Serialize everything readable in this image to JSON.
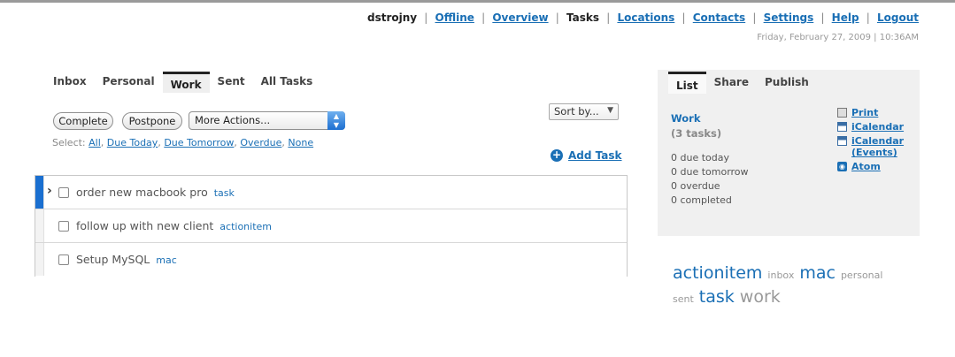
{
  "header": {
    "username": "dstrojny",
    "links": [
      {
        "label": "Offline",
        "current": false
      },
      {
        "label": "Overview",
        "current": false
      },
      {
        "label": "Tasks",
        "current": true
      },
      {
        "label": "Locations",
        "current": false
      },
      {
        "label": "Contacts",
        "current": false
      },
      {
        "label": "Settings",
        "current": false
      },
      {
        "label": "Help",
        "current": false
      },
      {
        "label": "Logout",
        "current": false
      }
    ],
    "datetime": "Friday, February 27, 2009 | 10:36AM"
  },
  "tabs": [
    "Inbox",
    "Personal",
    "Work",
    "Sent",
    "All Tasks"
  ],
  "active_tab": "Work",
  "toolbar": {
    "complete_label": "Complete",
    "postpone_label": "Postpone",
    "more_actions_label": "More Actions...",
    "sort_label": "Sort by..."
  },
  "select": {
    "prefix": "Select:",
    "options": [
      "All",
      "Due Today",
      "Due Tomorrow",
      "Overdue",
      "None"
    ]
  },
  "add_task_label": "Add Task",
  "tasks": [
    {
      "name": "order new macbook pro",
      "tag": "task",
      "selected": true
    },
    {
      "name": "follow up with new client",
      "tag": "actionitem",
      "selected": false
    },
    {
      "name": "Setup MySQL",
      "tag": "mac",
      "selected": false
    }
  ],
  "sidebar": {
    "tabs": [
      "List",
      "Share",
      "Publish"
    ],
    "active_tab": "List",
    "list_name": "Work",
    "task_count": "(3 tasks)",
    "stats": [
      "0 due today",
      "0 due tomorrow",
      "0 overdue",
      "0 completed"
    ],
    "actions": [
      "Print",
      "iCalendar",
      "iCalendar (Events)",
      "Atom"
    ]
  },
  "tag_cloud": [
    {
      "tag": "actionitem",
      "color": "#1a6fb5"
    },
    {
      "tag": "inbox",
      "color": "#999999"
    },
    {
      "tag": "mac",
      "color": "#1a6fb5"
    },
    {
      "tag": "personal",
      "color": "#999999"
    },
    {
      "tag": "sent",
      "color": "#999999"
    },
    {
      "tag": "task",
      "color": "#1a6fb5"
    },
    {
      "tag": "work",
      "color": "#999999"
    }
  ],
  "colors": {
    "accent": "#1a6fb5",
    "selected_bar": "#1a6fd0"
  }
}
